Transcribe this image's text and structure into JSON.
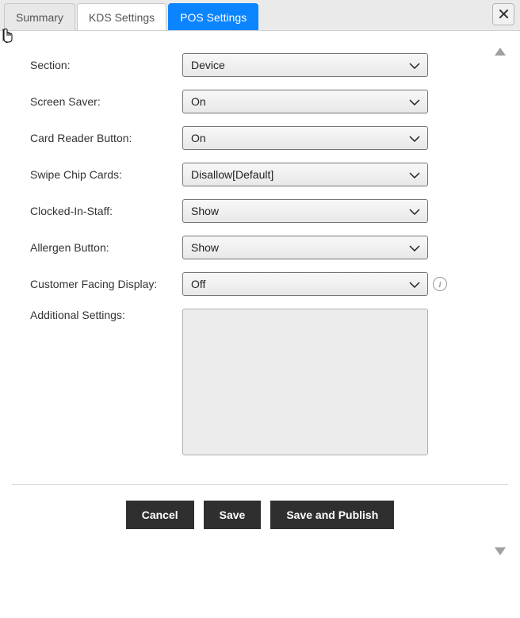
{
  "tabs": {
    "summary": "Summary",
    "kds": "KDS Settings",
    "pos": "POS Settings"
  },
  "form": {
    "section": {
      "label": "Section:",
      "value": "Device"
    },
    "screen_saver": {
      "label": "Screen Saver:",
      "value": "On"
    },
    "card_reader": {
      "label": "Card Reader Button:",
      "value": "On"
    },
    "swipe_chip": {
      "label": "Swipe Chip Cards:",
      "value": "Disallow[Default]"
    },
    "clocked_in": {
      "label": "Clocked-In-Staff:",
      "value": "Show"
    },
    "allergen": {
      "label": "Allergen Button:",
      "value": "Show"
    },
    "customer_display": {
      "label": "Customer Facing Display:",
      "value": "Off"
    },
    "additional": {
      "label": "Additional Settings:"
    }
  },
  "footer": {
    "cancel": "Cancel",
    "save": "Save",
    "save_publish": "Save and Publish"
  },
  "info_icon_text": "i"
}
